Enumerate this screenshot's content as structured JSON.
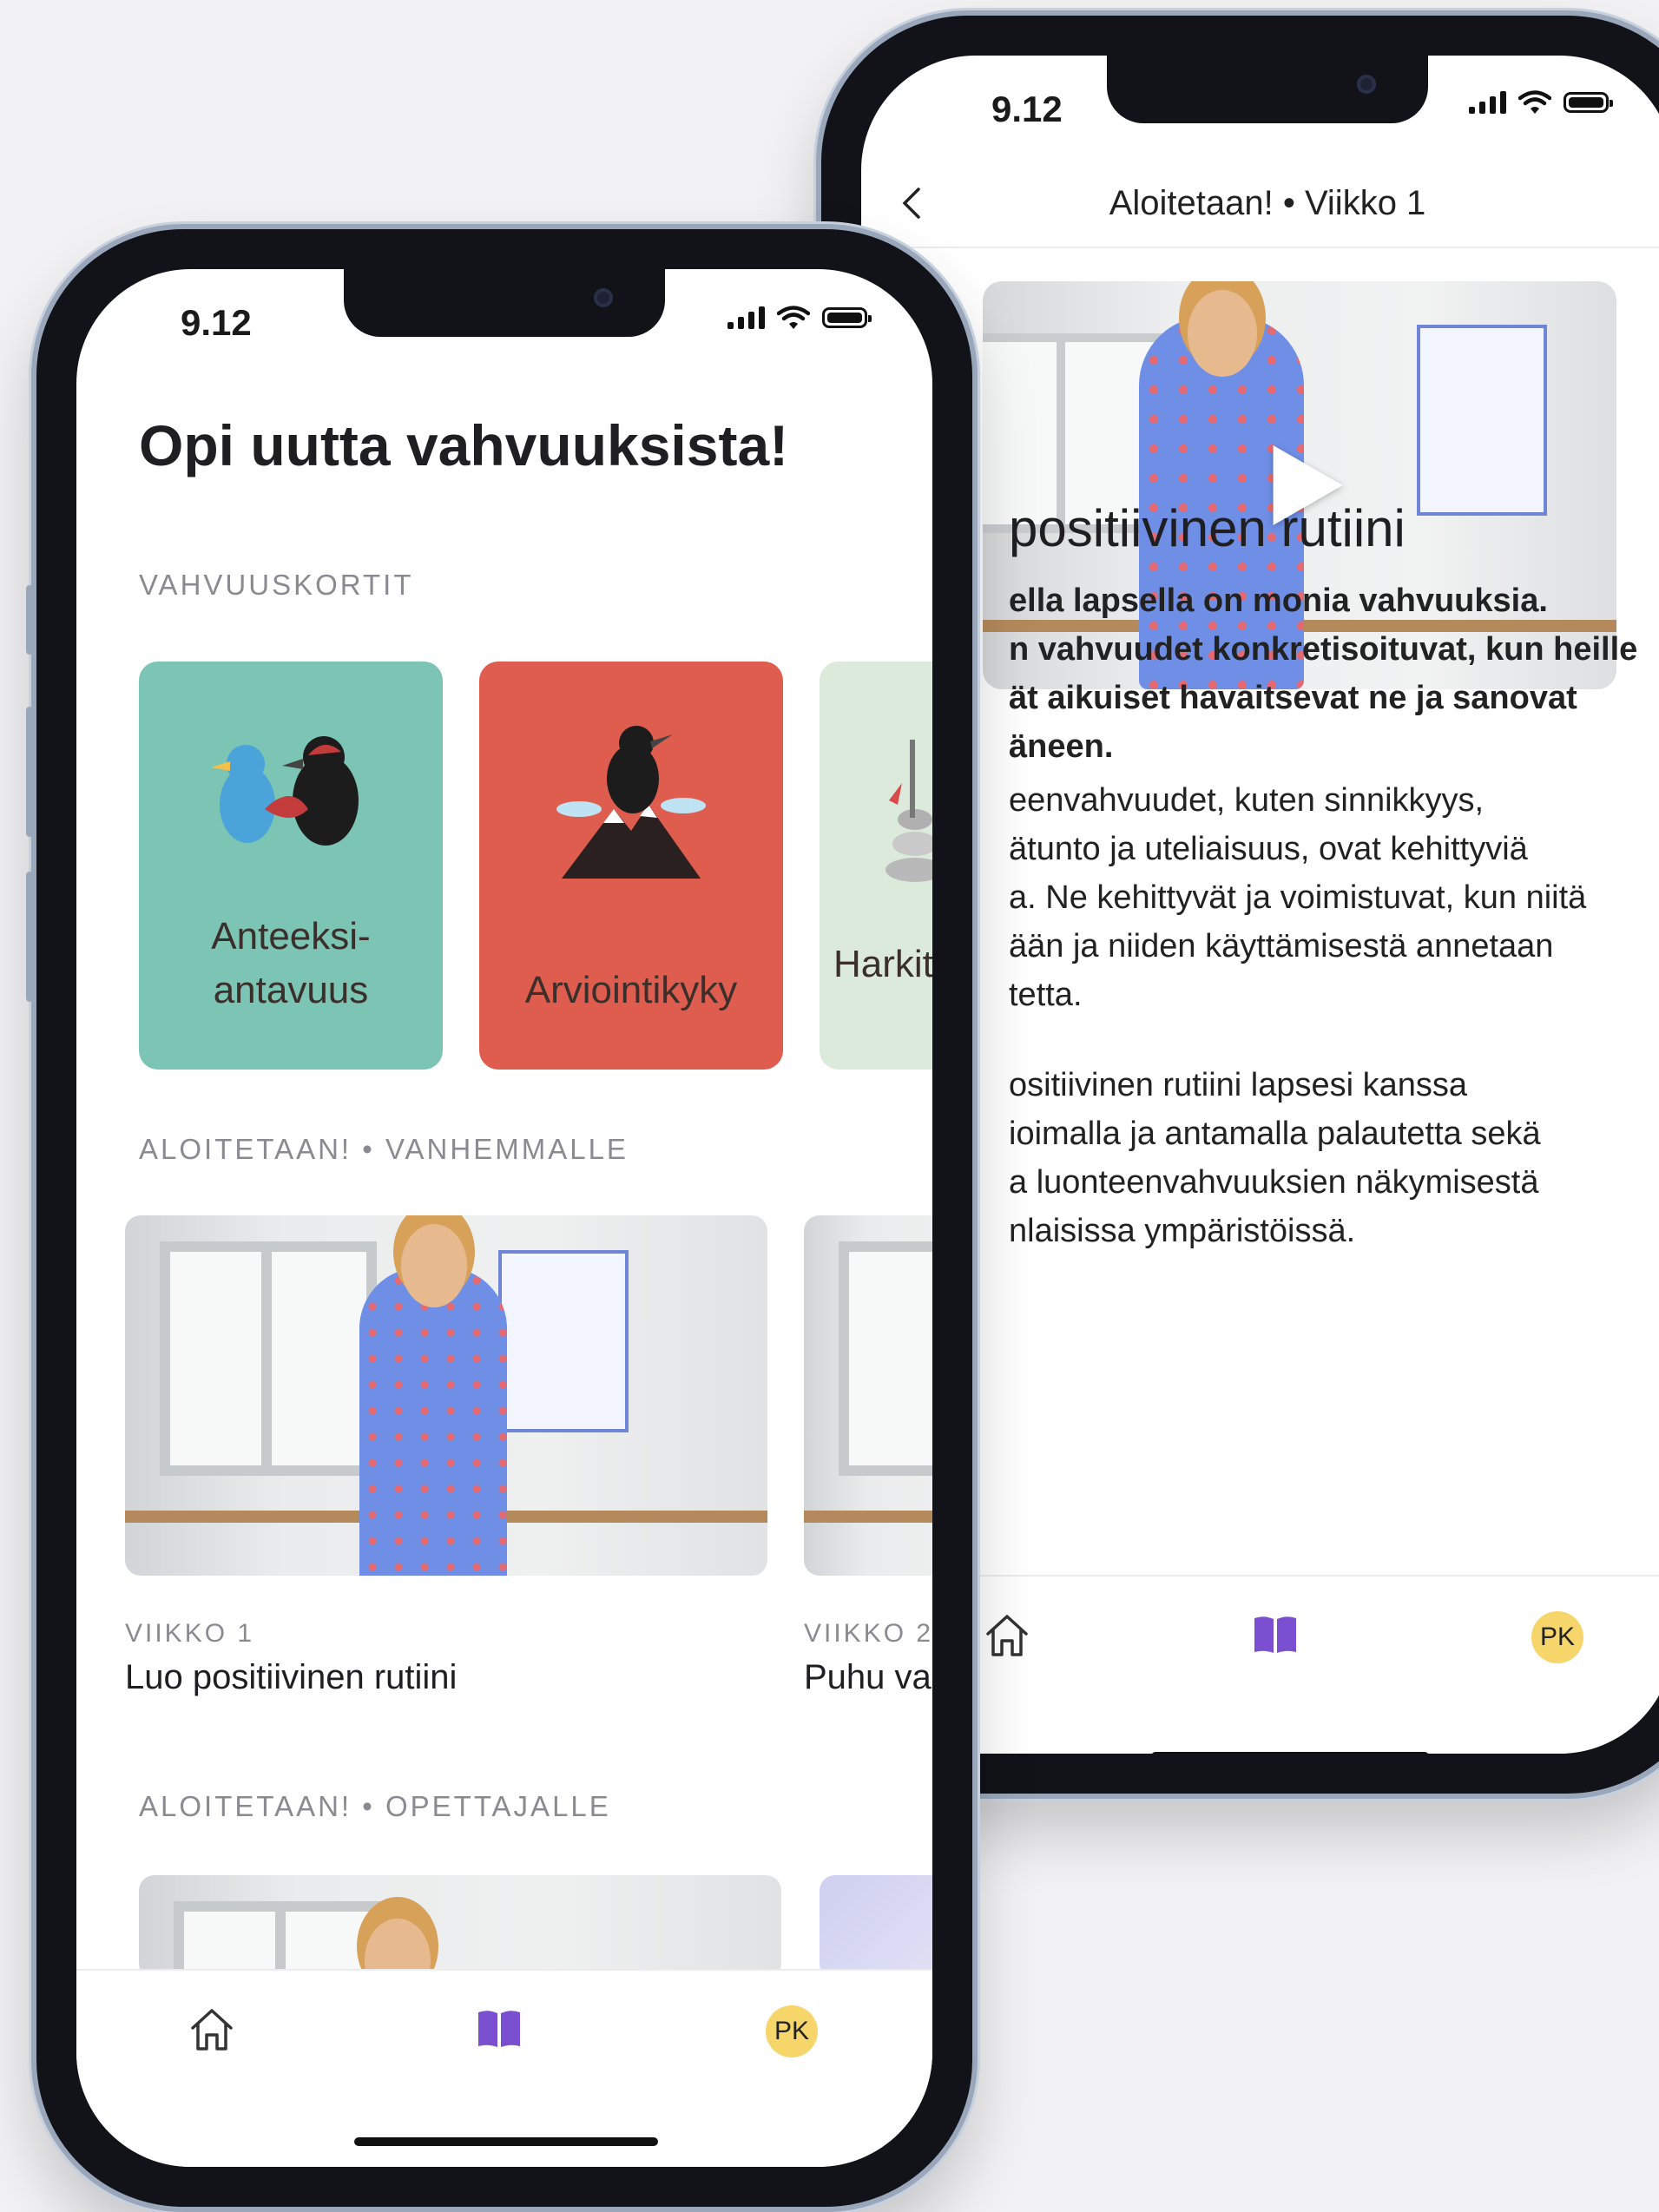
{
  "back_phone": {
    "status_time": "9.12",
    "header_title": "Aloitetaan! • Viikko 1",
    "heading": "positiivinen rutiini",
    "intro_lines": [
      "ella lapsella on monia vahvuuksia.",
      "n vahvuudet konkretisoituvat, kun heille",
      "ät aikuiset havaitsevat ne ja sanovat",
      "äneen."
    ],
    "para2_lines": [
      "eenvahvuudet, kuten sinnikkyys,",
      "ätunto ja uteliaisuus, ovat kehittyviä",
      "a. Ne kehittyvät ja voimistuvat, kun niitä",
      "ään ja niiden käyttämisestä annetaan",
      "tetta."
    ],
    "para3_lines": [
      "ositiivinen rutiini lapsesi kanssa",
      "ioimalla ja antamalla palautetta sekä",
      "a luonteenvahvuuksien näkymisestä",
      "nlaisissa ympäristöissä."
    ],
    "tabbar": {
      "home": "home-icon",
      "library": "book-icon",
      "avatar": "PK"
    }
  },
  "front_phone": {
    "status_time": "9.12",
    "title": "Opi uutta vahvuuksista!",
    "section_cards": "VAHVUUSKORTIT",
    "cards": [
      {
        "label": "Anteeksi-\nantavuus",
        "color": "#7cc4b4"
      },
      {
        "label": "Arviointikyky",
        "color": "#de5d4f"
      },
      {
        "label": "Harkitse",
        "color": "#dbeadb"
      }
    ],
    "section_parents": "ALOITETAAN! • VANHEMMALLE",
    "videos": [
      {
        "week": "VIIKKO 1",
        "title": "Luo positiivinen rutiini"
      },
      {
        "week": "VIIKKO 2",
        "title": "Puhu vahvu"
      }
    ],
    "section_teachers": "ALOITETAAN! • OPETTAJALLE",
    "tabbar": {
      "home": "home-icon",
      "library": "book-icon",
      "avatar": "PK"
    }
  },
  "colors": {
    "accent": "#7a4fd0",
    "avatar_bg": "#f6d66b"
  }
}
